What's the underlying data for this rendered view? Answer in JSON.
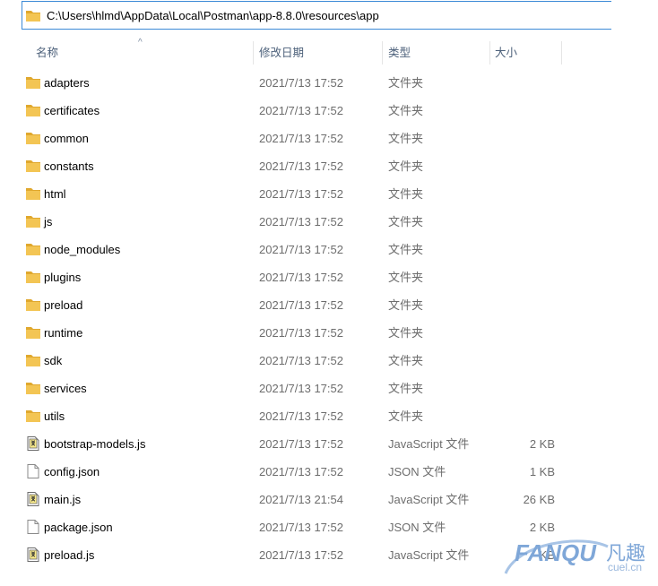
{
  "address_bar": {
    "path": "C:\\Users\\hlmd\\AppData\\Local\\Postman\\app-8.8.0\\resources\\app"
  },
  "columns": {
    "name": "名称",
    "date": "修改日期",
    "type": "类型",
    "size": "大小"
  },
  "files": [
    {
      "name": "adapters",
      "date": "2021/7/13 17:52",
      "type": "文件夹",
      "size": "",
      "icon": "folder-icon"
    },
    {
      "name": "certificates",
      "date": "2021/7/13 17:52",
      "type": "文件夹",
      "size": "",
      "icon": "folder-icon"
    },
    {
      "name": "common",
      "date": "2021/7/13 17:52",
      "type": "文件夹",
      "size": "",
      "icon": "folder-icon"
    },
    {
      "name": "constants",
      "date": "2021/7/13 17:52",
      "type": "文件夹",
      "size": "",
      "icon": "folder-icon"
    },
    {
      "name": "html",
      "date": "2021/7/13 17:52",
      "type": "文件夹",
      "size": "",
      "icon": "folder-icon"
    },
    {
      "name": "js",
      "date": "2021/7/13 17:52",
      "type": "文件夹",
      "size": "",
      "icon": "folder-icon"
    },
    {
      "name": "node_modules",
      "date": "2021/7/13 17:52",
      "type": "文件夹",
      "size": "",
      "icon": "folder-icon"
    },
    {
      "name": "plugins",
      "date": "2021/7/13 17:52",
      "type": "文件夹",
      "size": "",
      "icon": "folder-icon"
    },
    {
      "name": "preload",
      "date": "2021/7/13 17:52",
      "type": "文件夹",
      "size": "",
      "icon": "folder-icon"
    },
    {
      "name": "runtime",
      "date": "2021/7/13 17:52",
      "type": "文件夹",
      "size": "",
      "icon": "folder-icon"
    },
    {
      "name": "sdk",
      "date": "2021/7/13 17:52",
      "type": "文件夹",
      "size": "",
      "icon": "folder-icon"
    },
    {
      "name": "services",
      "date": "2021/7/13 17:52",
      "type": "文件夹",
      "size": "",
      "icon": "folder-icon"
    },
    {
      "name": "utils",
      "date": "2021/7/13 17:52",
      "type": "文件夹",
      "size": "",
      "icon": "folder-icon"
    },
    {
      "name": "bootstrap-models.js",
      "date": "2021/7/13 17:52",
      "type": "JavaScript 文件",
      "size": "2 KB",
      "icon": "js-file-icon"
    },
    {
      "name": "config.json",
      "date": "2021/7/13 17:52",
      "type": "JSON 文件",
      "size": "1 KB",
      "icon": "file-icon"
    },
    {
      "name": "main.js",
      "date": "2021/7/13 21:54",
      "type": "JavaScript 文件",
      "size": "26 KB",
      "icon": "js-file-icon"
    },
    {
      "name": "package.json",
      "date": "2021/7/13 17:52",
      "type": "JSON 文件",
      "size": "2 KB",
      "icon": "file-icon"
    },
    {
      "name": "preload.js",
      "date": "2021/7/13 17:52",
      "type": "JavaScript 文件",
      "size": "KB",
      "icon": "js-file-icon"
    }
  ],
  "watermark": {
    "brand": "FANQU",
    "brand_cn": "凡趣",
    "domain": "cuel.cn"
  },
  "colors": {
    "folder": "#f3c554",
    "folder_dark": "#e0a82e",
    "accent": "#3c8ad6"
  }
}
